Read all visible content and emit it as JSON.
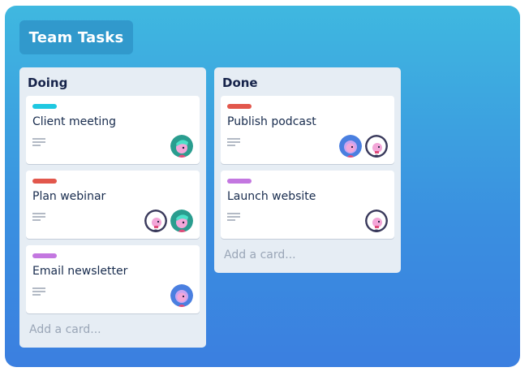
{
  "board": {
    "title": "Team Tasks"
  },
  "columns": [
    {
      "title": "Doing",
      "add_card": "Add a card...",
      "cards": [
        {
          "title": "Client meeting",
          "label_color": "#1fc8e1",
          "avatars": [
            "avatar-green"
          ]
        },
        {
          "title": "Plan webinar",
          "label_color": "#e2574c",
          "avatars": [
            "avatar-dark",
            "avatar-green"
          ]
        },
        {
          "title": "Email newsletter",
          "label_color": "#c377e0",
          "avatars": [
            "avatar-purple"
          ]
        }
      ]
    },
    {
      "title": "Done",
      "add_card": "Add a card...",
      "cards": [
        {
          "title": "Publish podcast",
          "label_color": "#e2574c",
          "avatars": [
            "avatar-purple",
            "avatar-dark"
          ]
        },
        {
          "title": "Launch website",
          "label_color": "#c377e0",
          "avatars": [
            "avatar-dark"
          ]
        }
      ]
    }
  ],
  "colors": {
    "board_gradient_top": "#3fb8e0",
    "board_gradient_bottom": "#3b7fe0",
    "title_box": "#3199cc",
    "column_bg": "#e6edf4"
  }
}
